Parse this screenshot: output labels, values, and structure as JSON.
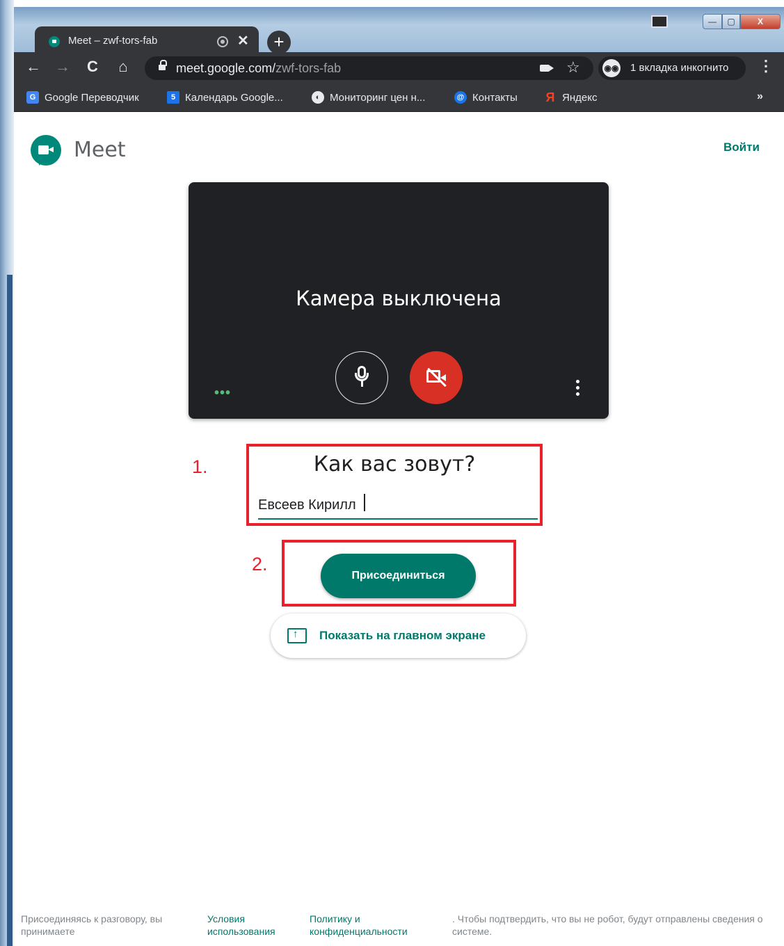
{
  "browser": {
    "tab_title": "Meet – zwf-tors-fab",
    "tab_close": "✕",
    "new_tab": "+",
    "url_domain": "meet.google.com/",
    "url_path": "zwf-tors-fab",
    "incognito_label": "1 вкладка инкогнито",
    "window_controls": {
      "minimize": "—",
      "maximize": "▢",
      "close": "X"
    },
    "nav": {
      "back": "←",
      "forward": "→",
      "reload": "C",
      "home": "⌂",
      "star": "☆",
      "menu": "⋮"
    }
  },
  "bookmarks": {
    "items": [
      {
        "label": "Google Переводчик",
        "icon": "G"
      },
      {
        "label": "Календарь Google...",
        "icon": "5"
      },
      {
        "label": "Мониторинг цен н...",
        "icon": "◐"
      },
      {
        "label": "Контакты",
        "icon": "@"
      },
      {
        "label": "Яндекс",
        "icon": "Я"
      }
    ],
    "more": "»"
  },
  "page": {
    "brand": "Meet",
    "signin": "Войти",
    "camera_off": "Камера выключена",
    "dots": "•••",
    "name_prompt": "Как вас зовут?",
    "name_value": "Евсеев Кирилл",
    "join_label": "Присоединиться",
    "present_label": "Показать на главном экране",
    "annotation_1": "1.",
    "annotation_2": "2."
  },
  "footer": {
    "text_1": "Присоединяясь к разговору, вы принимаете",
    "terms": "Условия использования",
    "privacy": "Политику и конфиденциальности",
    "text_2": ". Чтобы подтвердить, что вы не робот, будут отправлены сведения о системе."
  },
  "colors": {
    "accent": "#00796b",
    "camera_off_red": "#d93025",
    "annotation_red": "#e8212b",
    "browser_dark": "#35363a"
  }
}
